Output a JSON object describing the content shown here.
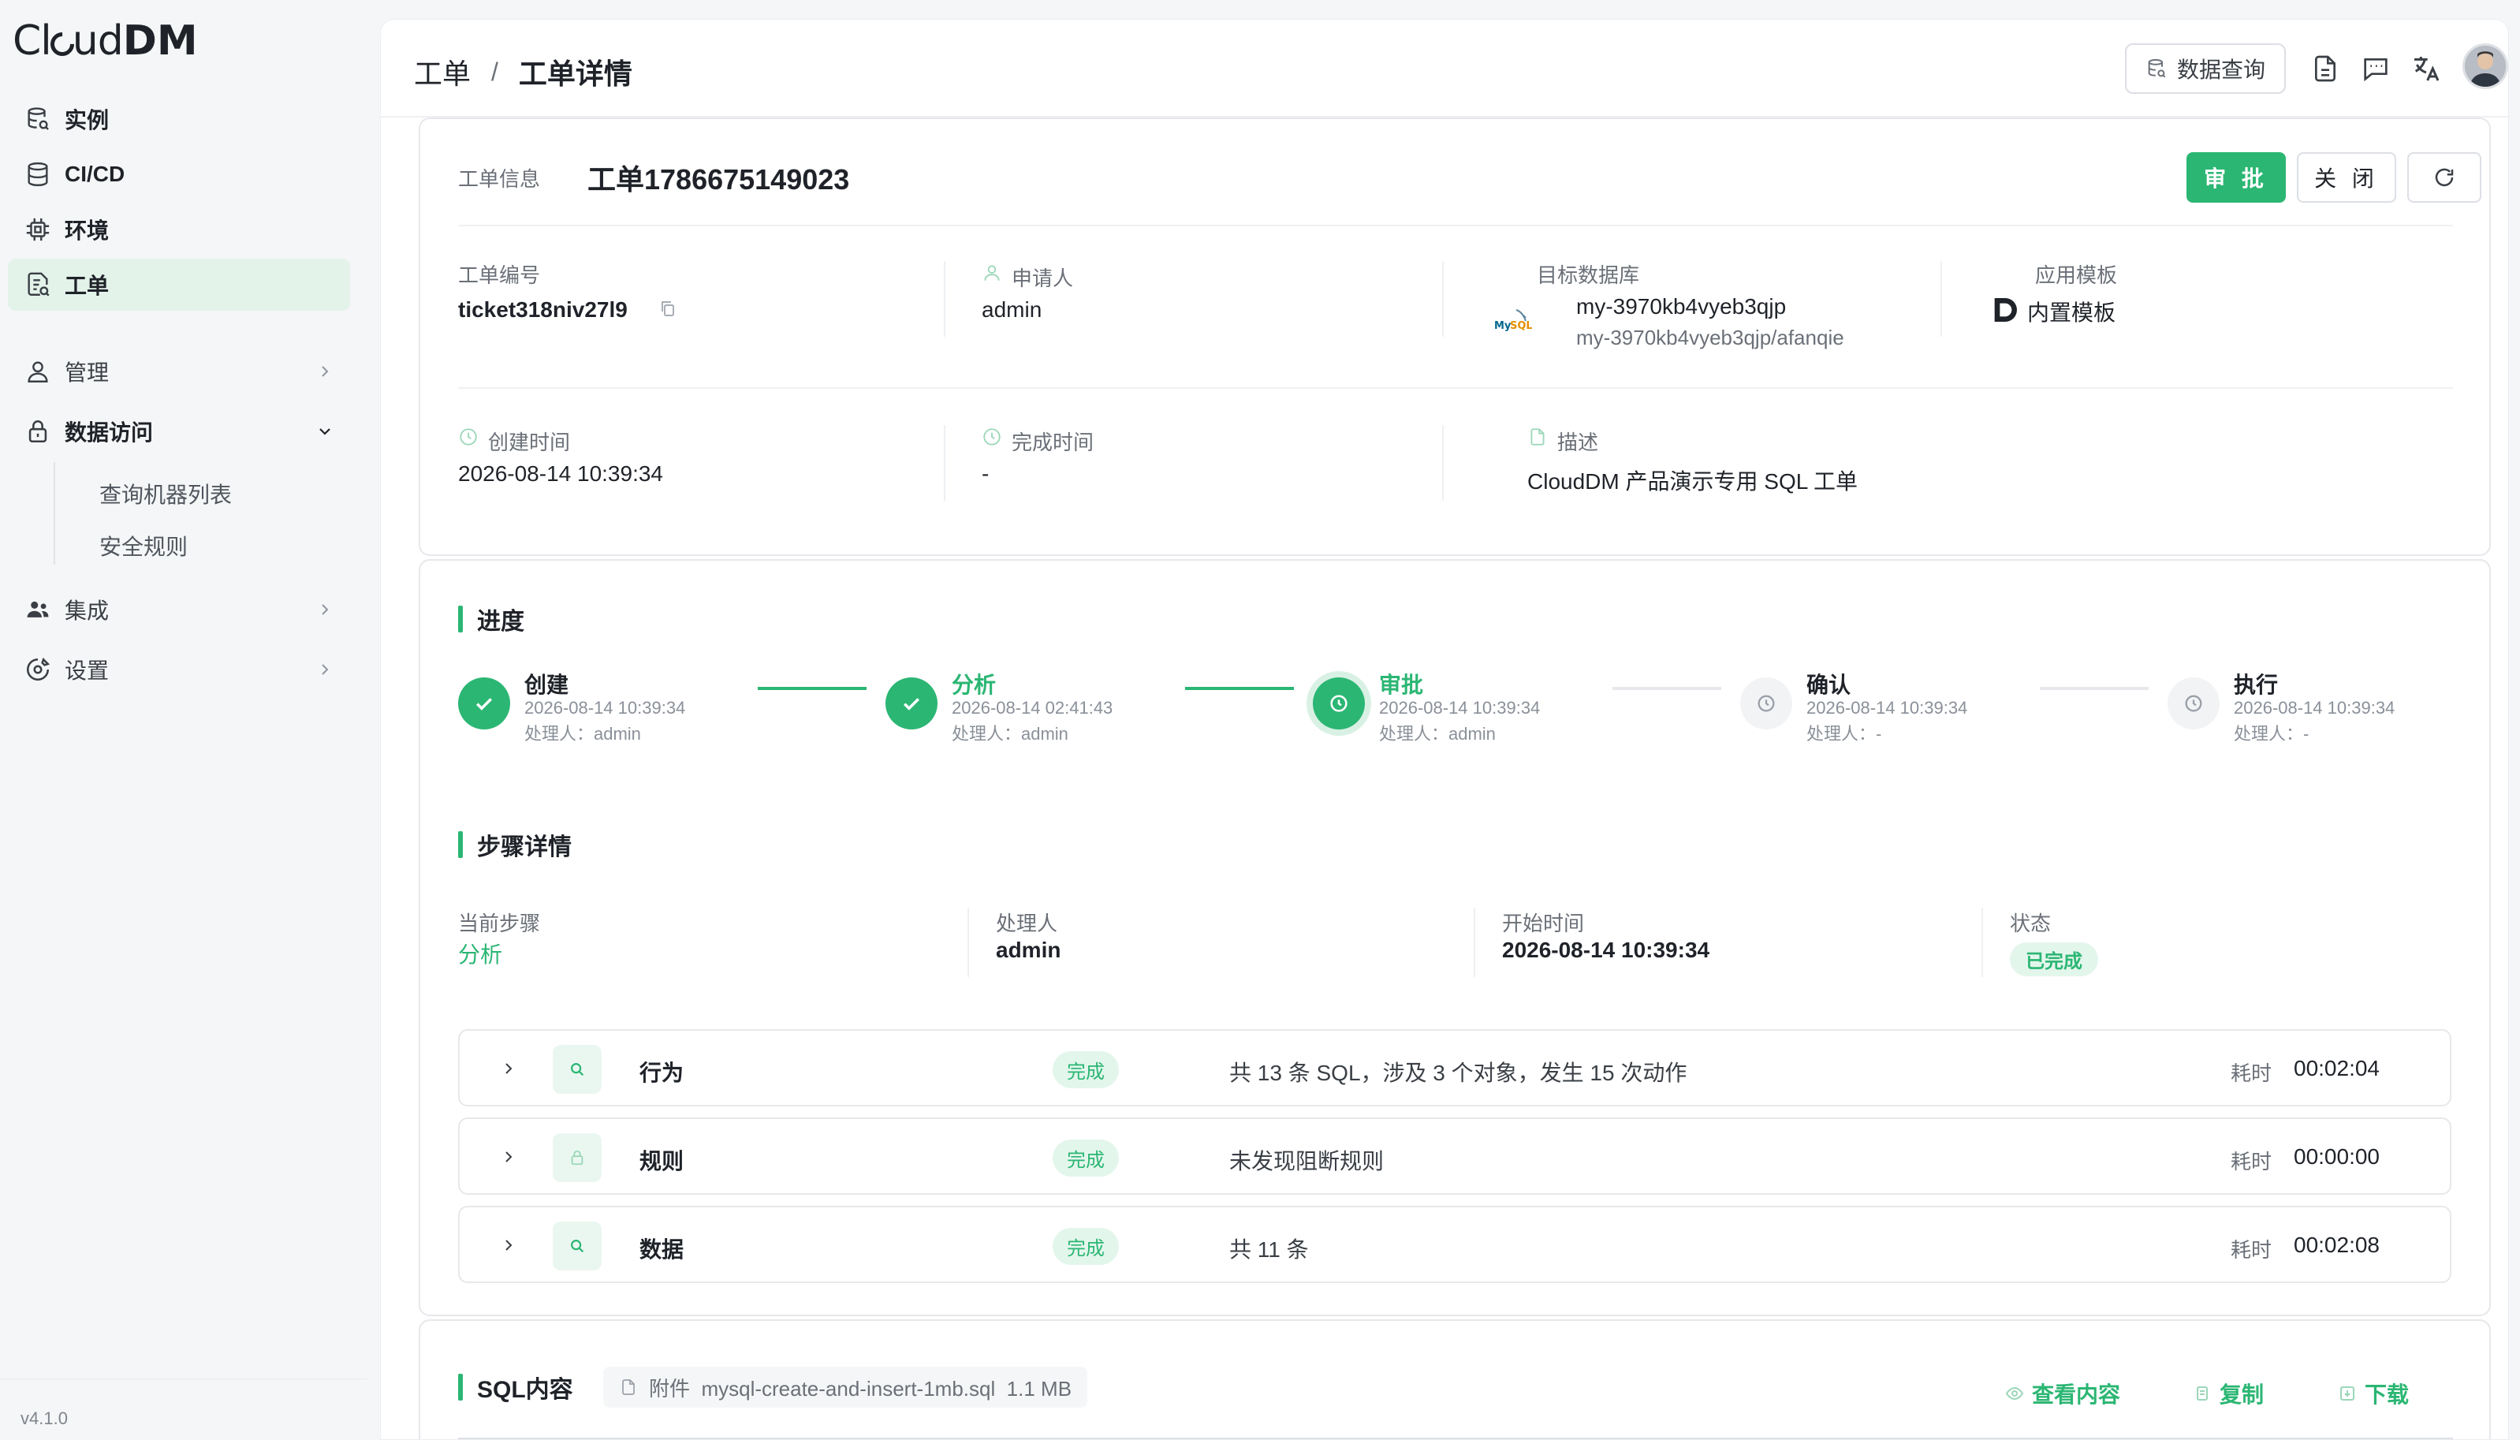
{
  "app": {
    "logo_light": "Cl",
    "logo_mid": "ud",
    "logo_bold": "DM",
    "version": "v4.1.0"
  },
  "sidebar": {
    "items": [
      {
        "label": "实例",
        "icon": "database-stack-icon"
      },
      {
        "label": "CI/CD",
        "icon": "database-icon"
      },
      {
        "label": "环境",
        "icon": "chip-icon"
      },
      {
        "label": "工单",
        "icon": "ticket-icon"
      },
      {
        "label": "管理",
        "icon": "user-admin-icon"
      },
      {
        "label": "数据访问",
        "icon": "lock-icon"
      },
      {
        "label": "集成",
        "icon": "users-icon"
      },
      {
        "label": "设置",
        "icon": "settings-icon"
      }
    ],
    "sub_items": [
      "查询机器列表",
      "安全规则"
    ]
  },
  "header": {
    "breadcrumb": [
      "工单",
      "工单详情"
    ],
    "separator": "/",
    "data_query_label": "数据查询"
  },
  "ticket": {
    "section_label": "工单信息",
    "title": "工单1786675149023",
    "approve_label": "审 批",
    "close_label": "关 闭",
    "fields": {
      "number_label": "工单编号",
      "number_value": "ticket318niv27l9",
      "applicant_label": "申请人",
      "applicant_value": "admin",
      "target_db_label": "目标数据库",
      "target_db_value": "my-3970kb4vyeb3qjp",
      "target_db_sub": "my-3970kb4vyeb3qjp/afanqie",
      "template_label": "应用模板",
      "template_value": "内置模板",
      "created_label": "创建时间",
      "created_value": "2026-08-14 10:39:34",
      "finished_label": "完成时间",
      "finished_value": "-",
      "desc_label": "描述",
      "desc_value": "CloudDM 产品演示专用 SQL 工单"
    }
  },
  "progress": {
    "title": "进度",
    "steps": [
      {
        "name": "创建",
        "time": "2026-08-14 10:39:34",
        "handler": "处理人：admin",
        "state": "done"
      },
      {
        "name": "分析",
        "time": "2026-08-14 02:41:43",
        "handler": "处理人：admin",
        "state": "done"
      },
      {
        "name": "审批",
        "time": "2026-08-14 10:39:34",
        "handler": "处理人：admin",
        "state": "current"
      },
      {
        "name": "确认",
        "time": "2026-08-14 10:39:34",
        "handler": "处理人：-",
        "state": "wait"
      },
      {
        "name": "执行",
        "time": "2026-08-14 10:39:34",
        "handler": "处理人：-",
        "state": "wait"
      }
    ]
  },
  "step_details": {
    "title": "步骤详情",
    "current_step_label": "当前步骤",
    "current_step_value": "分析",
    "handler_label": "处理人",
    "handler_value": "admin",
    "start_label": "开始时间",
    "start_value": "2026-08-14 10:39:34",
    "status_label": "状态",
    "status_value": "已完成",
    "rows": [
      {
        "name": "行为",
        "tag": "完成",
        "desc": "共 13 条 SQL，涉及 3 个对象，发生 15 次动作",
        "time_label": "耗时",
        "time": "00:02:04",
        "icon": "search-icon"
      },
      {
        "name": "规则",
        "tag": "完成",
        "desc": "未发现阻断规则",
        "time_label": "耗时",
        "time": "00:00:00",
        "icon": "lock-icon"
      },
      {
        "name": "数据",
        "tag": "完成",
        "desc": "共 11 条",
        "time_label": "耗时",
        "time": "00:02:08",
        "icon": "search-icon"
      }
    ]
  },
  "sql": {
    "title": "SQL内容",
    "attachment": "附件  mysql-create-and-insert-1mb.sql  1.1 MB",
    "view_label": "查看内容",
    "copy_label": "复制",
    "download_label": "下载"
  },
  "colors": {
    "accent": "#2bb673",
    "active_bg": "#e3f3ea",
    "text": "#1f2329",
    "muted": "#6b7078"
  }
}
